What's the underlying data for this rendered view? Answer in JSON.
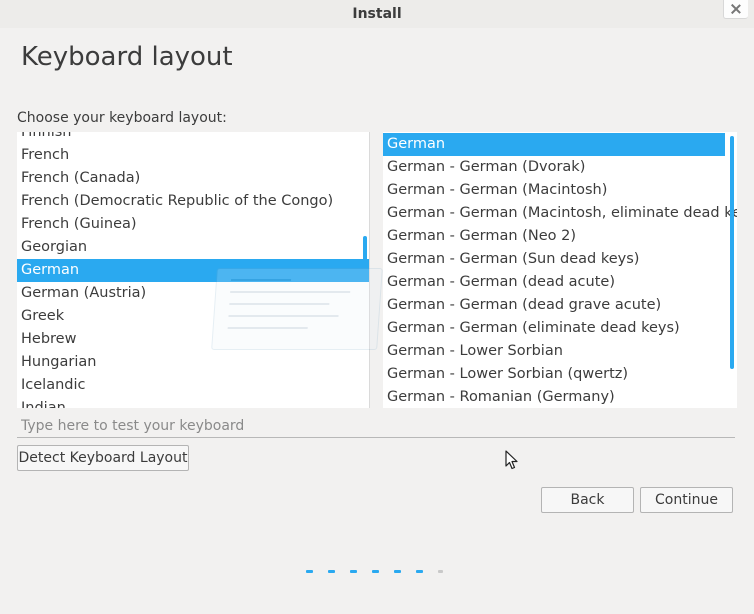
{
  "window": {
    "title": "Install"
  },
  "page": {
    "title": "Keyboard layout",
    "choose_label": "Choose your keyboard layout:"
  },
  "layouts": [
    {
      "label": "Finnish"
    },
    {
      "label": "French"
    },
    {
      "label": "French (Canada)"
    },
    {
      "label": "French (Democratic Republic of the Congo)"
    },
    {
      "label": "French (Guinea)"
    },
    {
      "label": "Georgian"
    },
    {
      "label": "German",
      "selected": true
    },
    {
      "label": "German (Austria)"
    },
    {
      "label": "Greek"
    },
    {
      "label": "Hebrew"
    },
    {
      "label": "Hungarian"
    },
    {
      "label": "Icelandic"
    },
    {
      "label": "Indian"
    }
  ],
  "variants": [
    {
      "label": "German",
      "selected": true
    },
    {
      "label": "German - German (Dvorak)"
    },
    {
      "label": "German - German (Macintosh)"
    },
    {
      "label": "German - German (Macintosh, eliminate dead keys)"
    },
    {
      "label": "German - German (Neo 2)"
    },
    {
      "label": "German - German (Sun dead keys)"
    },
    {
      "label": "German - German (dead acute)"
    },
    {
      "label": "German - German (dead grave acute)"
    },
    {
      "label": "German - German (eliminate dead keys)"
    },
    {
      "label": "German - Lower Sorbian"
    },
    {
      "label": "German - Lower Sorbian (qwertz)"
    },
    {
      "label": "German - Romanian (Germany)"
    }
  ],
  "test_input": {
    "value": "",
    "placeholder": "Type here to test your keyboard"
  },
  "buttons": {
    "detect": "Detect Keyboard Layout",
    "back": "Back",
    "continue": "Continue"
  },
  "progress": {
    "total_steps": 7,
    "completed_steps": 6
  },
  "colors": {
    "accent": "#2aa9f0",
    "background": "#f2f1f0",
    "text": "#3c3c3c"
  },
  "icons": {
    "close": "close-icon",
    "cursor": "mouse-pointer-icon"
  }
}
